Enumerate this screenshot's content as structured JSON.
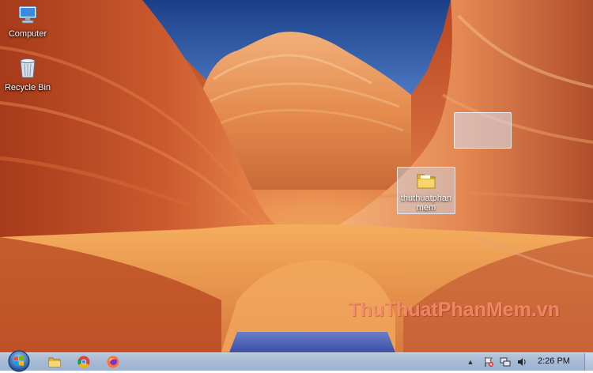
{
  "desktop": {
    "icons": [
      {
        "label": "Computer",
        "icon": "computer-icon"
      },
      {
        "label": "Recycle Bin",
        "icon": "recycle-bin-icon"
      }
    ],
    "selected_folder": {
      "label": "thuthuatphanmem",
      "icon": "folder-icon"
    },
    "watermark": "ThuThuatPhanMem.vn"
  },
  "taskbar": {
    "start_icon": "windows-start-icon",
    "pinned": [
      {
        "name": "File Explorer",
        "icon": "folder-icon"
      },
      {
        "name": "Google Chrome",
        "icon": "chrome-icon"
      },
      {
        "name": "Firefox",
        "icon": "firefox-icon"
      }
    ],
    "tray": {
      "arrow": "▲",
      "icons": [
        "flag-icon",
        "network-icon",
        "volume-icon"
      ],
      "clock": "2:26 PM"
    }
  },
  "colors": {
    "taskbar": "#a8bbd5",
    "sky": "#1e4d9a",
    "rock": "#d4663a"
  }
}
